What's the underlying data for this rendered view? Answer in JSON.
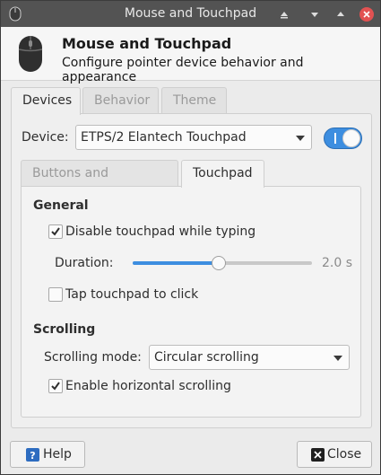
{
  "window": {
    "title": "Mouse and Touchpad"
  },
  "header": {
    "title": "Mouse and Touchpad",
    "subtitle": "Configure pointer device behavior and appearance"
  },
  "outer_tabs": [
    {
      "label": "Devices",
      "active": true
    },
    {
      "label": "Behavior",
      "active": false
    },
    {
      "label": "Theme",
      "active": false
    }
  ],
  "device": {
    "label": "Device:",
    "value": "ETPS/2 Elantech Touchpad",
    "enabled": true
  },
  "inner_tabs": [
    {
      "label": "Buttons and Feedback",
      "active": false
    },
    {
      "label": "Touchpad",
      "active": true
    }
  ],
  "general": {
    "title": "General",
    "disable_while_typing": {
      "label": "Disable touchpad while typing",
      "checked": true
    },
    "duration": {
      "label": "Duration:",
      "value_text": "2.0 s",
      "fraction": 0.48
    },
    "tap_to_click": {
      "label": "Tap touchpad to click",
      "checked": false
    }
  },
  "scrolling": {
    "title": "Scrolling",
    "mode_label": "Scrolling mode:",
    "mode_value": "Circular scrolling",
    "horizontal": {
      "label": "Enable horizontal scrolling",
      "checked": true
    }
  },
  "footer": {
    "help_label": "Help",
    "close_label": "Close"
  },
  "colors": {
    "accent": "#3d8ee0",
    "titlebar": "#535353"
  }
}
